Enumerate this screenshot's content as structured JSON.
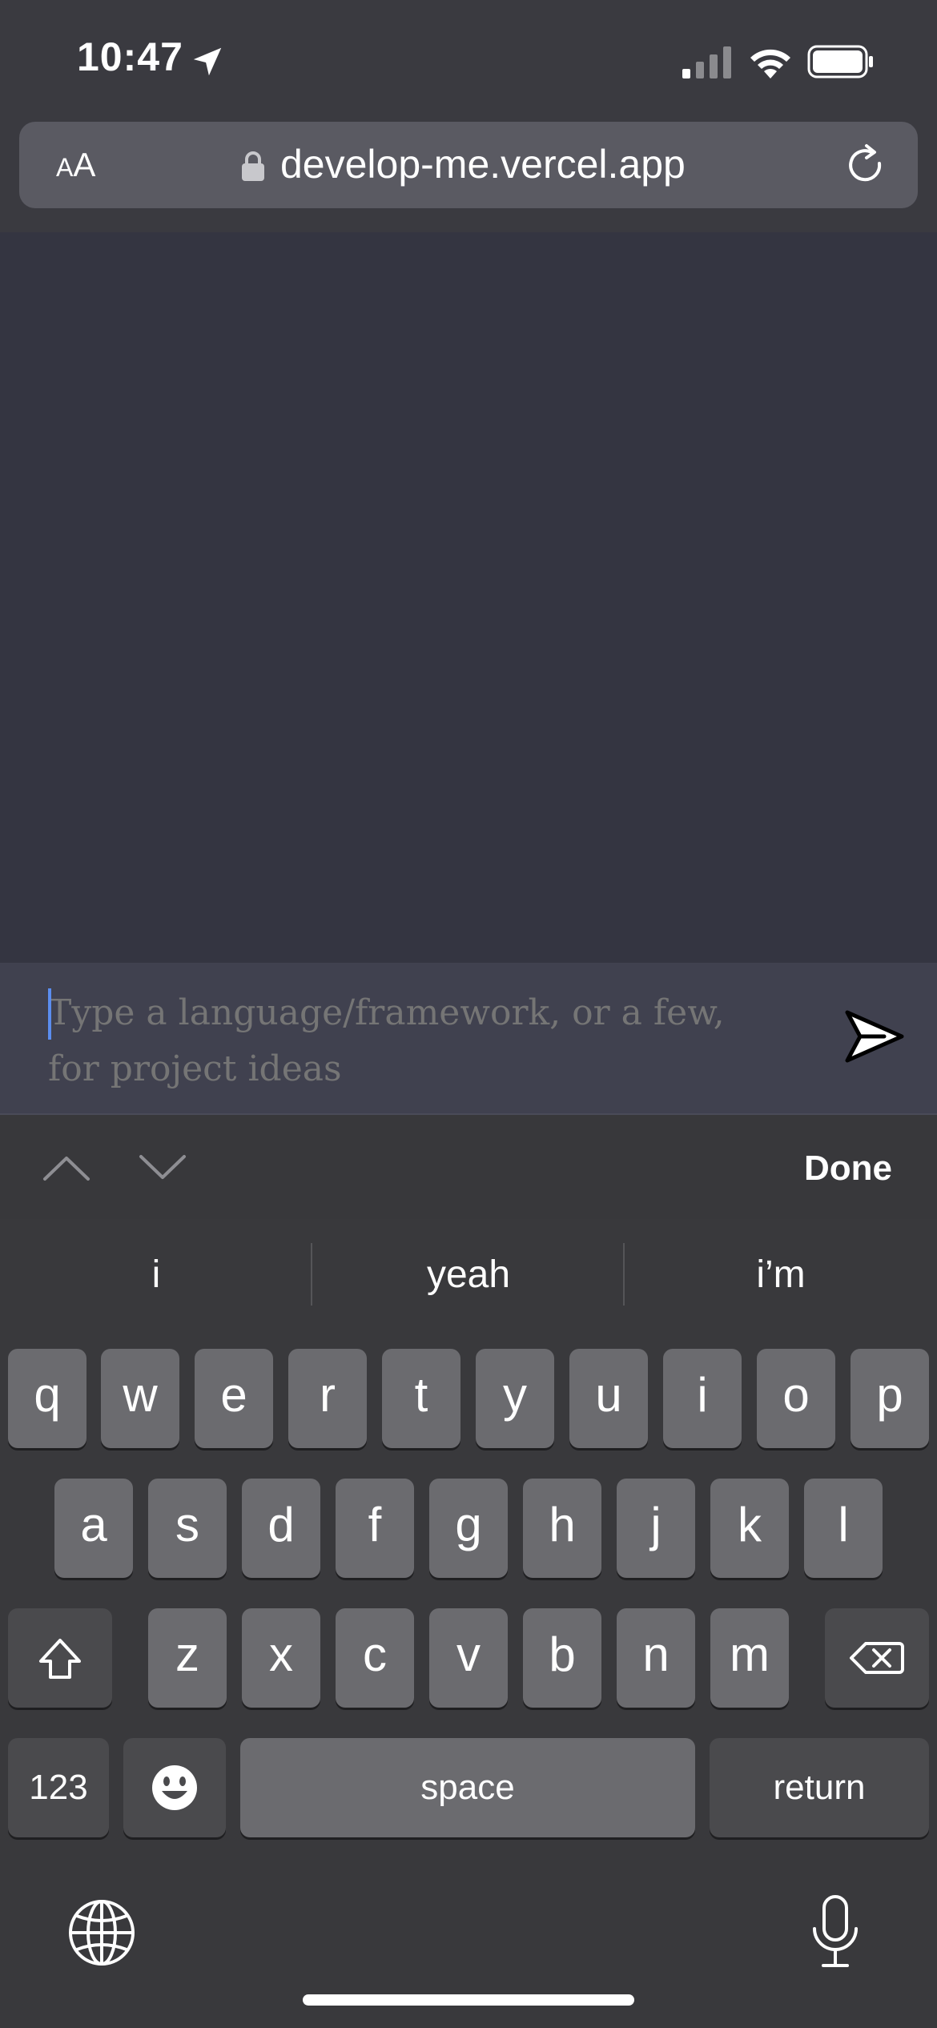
{
  "status_bar": {
    "time": "10:47"
  },
  "browser": {
    "text_size_label_small": "A",
    "text_size_label_large": "A",
    "url": "develop-me.vercel.app"
  },
  "chat": {
    "input_placeholder": "Type a language/framework, or a few, for project ideas",
    "input_value": ""
  },
  "keyboard": {
    "done_label": "Done",
    "suggestions": [
      "i",
      "yeah",
      "i’m"
    ],
    "row1": [
      "q",
      "w",
      "e",
      "r",
      "t",
      "y",
      "u",
      "i",
      "o",
      "p"
    ],
    "row2": [
      "a",
      "s",
      "d",
      "f",
      "g",
      "h",
      "j",
      "k",
      "l"
    ],
    "row3": [
      "z",
      "x",
      "c",
      "v",
      "b",
      "n",
      "m"
    ],
    "numbers_label": "123",
    "space_label": "space",
    "return_label": "return"
  },
  "colors": {
    "page_background": "#343541",
    "input_background": "#40414f",
    "caret": "#5b8def",
    "key_light": "#6b6b6f",
    "key_dark": "#4a4a4d"
  }
}
